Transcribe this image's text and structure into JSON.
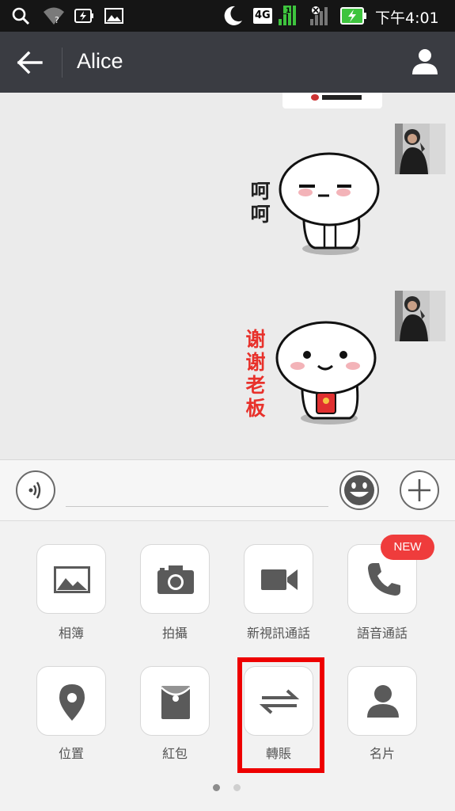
{
  "status_bar": {
    "time": "下午4:01",
    "network": "4G",
    "icons": [
      "search-icon",
      "wifi-icon",
      "battery-flash-icon",
      "image-icon",
      "moon-icon",
      "signal-icon",
      "battery-charging-icon"
    ]
  },
  "header": {
    "title": "Alice",
    "back_icon": "back-arrow-icon",
    "profile_icon": "person-icon"
  },
  "chat": {
    "messages": [
      {
        "type": "sticker",
        "sender": "me",
        "text": "呵呵",
        "text_color": "#222222"
      },
      {
        "type": "sticker",
        "sender": "me",
        "text": "谢谢老板",
        "text_color": "#e8312b"
      }
    ]
  },
  "input_bar": {
    "voice_icon": "voice-icon",
    "emoji_icon": "emoji-icon",
    "add_icon": "plus-icon"
  },
  "panel": {
    "items": [
      {
        "label": "相簿",
        "icon": "album-icon"
      },
      {
        "label": "拍攝",
        "icon": "camera-icon"
      },
      {
        "label": "新視訊通話",
        "icon": "video-call-icon"
      },
      {
        "label": "語音通話",
        "icon": "phone-icon",
        "badge": "NEW"
      },
      {
        "label": "位置",
        "icon": "location-icon"
      },
      {
        "label": "紅包",
        "icon": "red-envelope-icon"
      },
      {
        "label": "轉賬",
        "icon": "transfer-icon",
        "highlighted": true
      },
      {
        "label": "名片",
        "icon": "contact-card-icon"
      }
    ],
    "page_indicator": {
      "pages": 2,
      "current": 1
    }
  },
  "colors": {
    "header_bg": "#3a3c42",
    "highlight": "#ee0000",
    "badge": "#ef3c3c",
    "icon": "#5a5a5a"
  }
}
